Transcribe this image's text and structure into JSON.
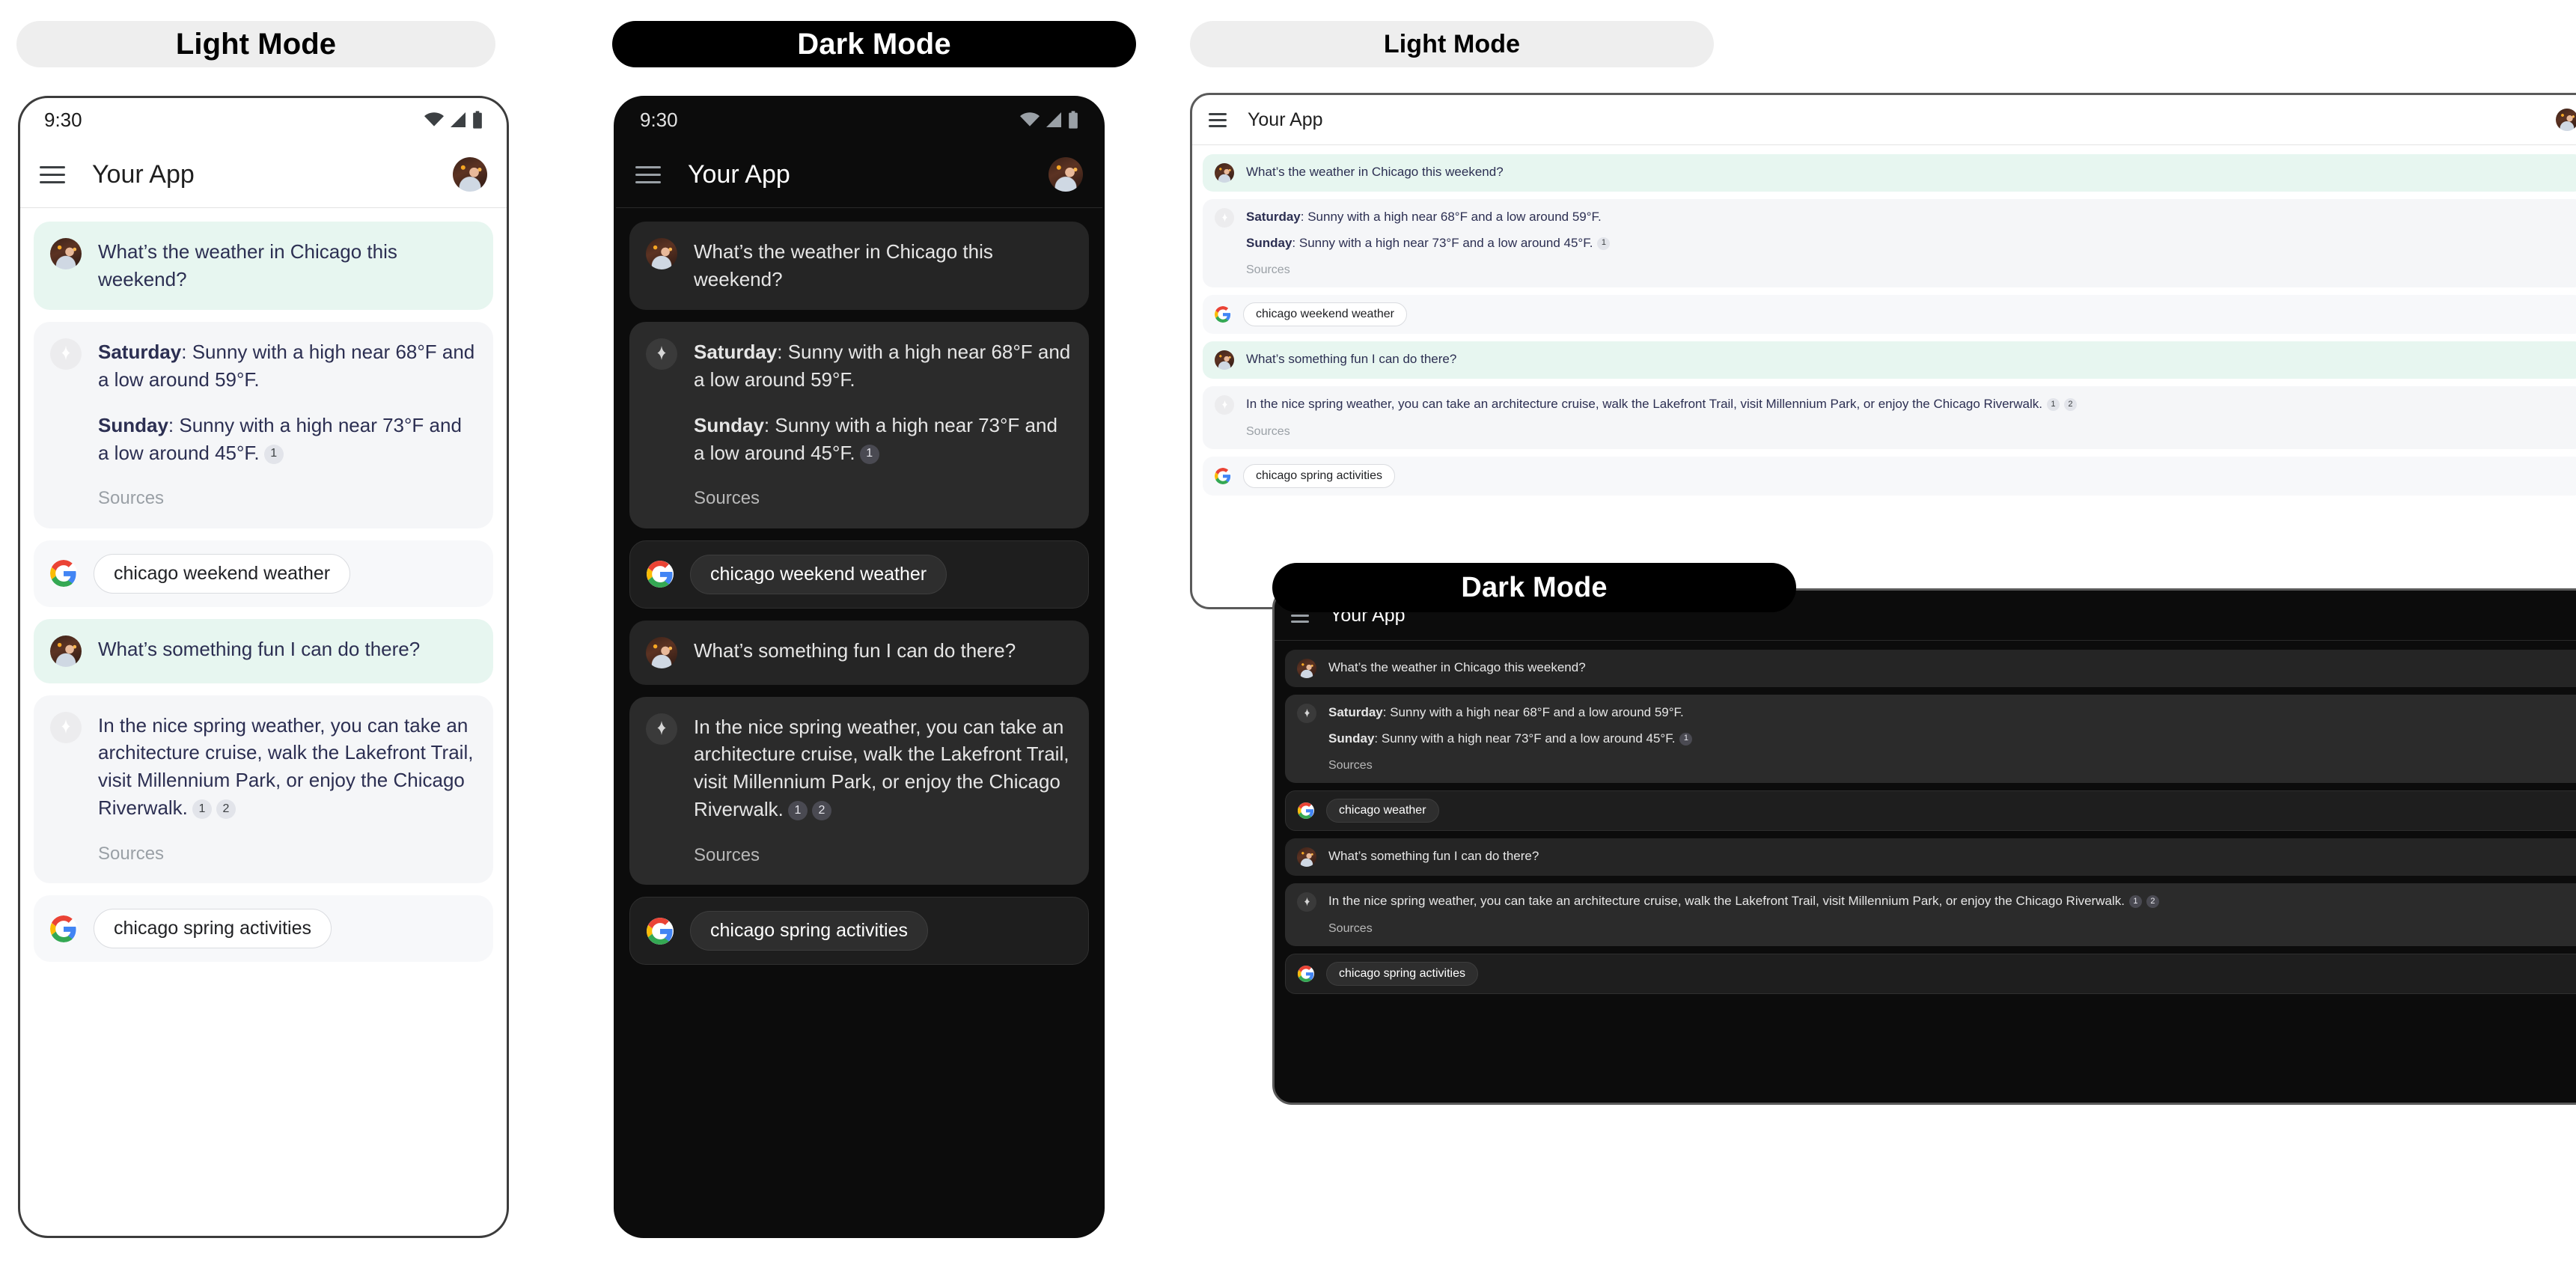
{
  "labels": {
    "phone_light": "Light Mode",
    "phone_dark": "Dark Mode",
    "tablet_light": "Light Mode",
    "tablet_dark": "Dark Mode"
  },
  "status_bar": {
    "time": "9:30",
    "icons": [
      "wifi-icon",
      "cell-signal-icon",
      "battery-icon"
    ]
  },
  "appbar": {
    "menu_icon": "hamburger-menu-icon",
    "title": "Your App",
    "avatar": "user-avatar"
  },
  "conversation": {
    "turn1": {
      "user": {
        "avatar": "user-avatar",
        "text": "What’s the weather in Chicago this weekend?"
      },
      "assistant": {
        "icon": "sparkle-icon",
        "line1_label": "Saturday",
        "line1_text": ": Sunny with a high near 68°F and a low around 59°F.",
        "line2_label": "Sunday",
        "line2_text": ": Sunny with a high near 73°F and a low around 45°F.",
        "citations": [
          "1"
        ],
        "sources_label": "Sources"
      },
      "search": {
        "logo": "google-logo",
        "query_phone_light": "chicago weekend weather",
        "query_phone_dark": "chicago weekend weather",
        "query_tablet_light": "chicago weekend weather",
        "query_tablet_dark": "chicago weather"
      }
    },
    "turn2": {
      "user": {
        "avatar": "user-avatar",
        "text": "What’s something fun I can do there?"
      },
      "assistant": {
        "icon": "sparkle-icon",
        "text": "In the nice spring weather, you can take an architecture cruise, walk the Lakefront Trail, visit Millennium Park, or enjoy the Chicago Riverwalk.",
        "citations": [
          "1",
          "2"
        ],
        "sources_label": "Sources"
      },
      "search": {
        "logo": "google-logo",
        "query": "chicago spring activities"
      }
    }
  },
  "colors": {
    "user_bubble_light": "#e7f6f0",
    "user_bubble_dark": "#252525",
    "bot_bubble_light": "#f5f6f8",
    "bot_bubble_dark": "#2b2b2b",
    "text_light": "#2c2f52",
    "text_dark": "#e6e6e6",
    "sources_light": "#9aa0a6",
    "pill_light_bg": "#eeeeee",
    "pill_dark_bg": "#000000"
  }
}
